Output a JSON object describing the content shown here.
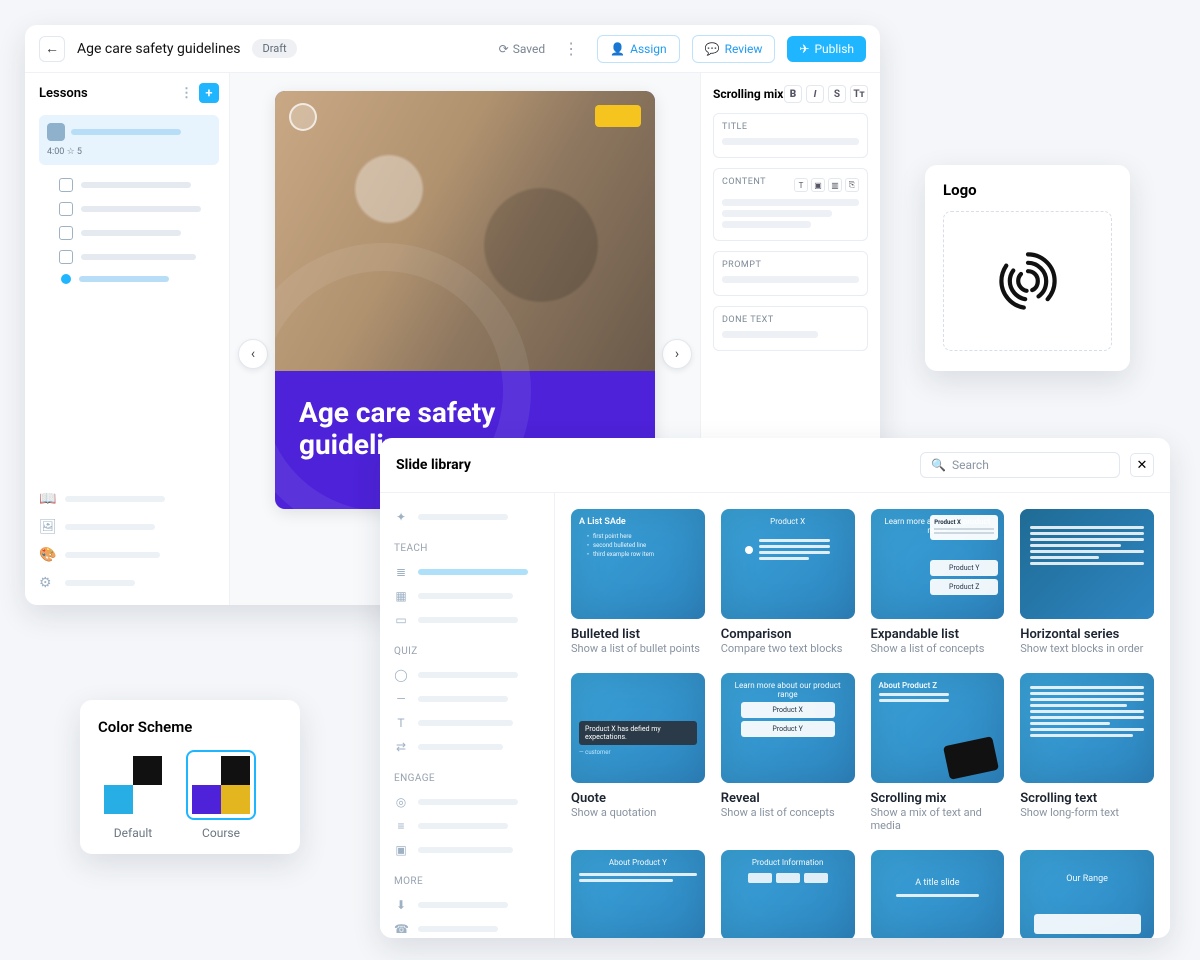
{
  "editor": {
    "title": "Age care safety guidelines",
    "status_pill": "Draft",
    "saved_label": "Saved",
    "buttons": {
      "assign": "Assign",
      "review": "Review",
      "publish": "Publish"
    },
    "lessons_label": "Lessons",
    "lesson_meta": "4:00  ☆ 5",
    "slide_title": "Age care safety guidelines",
    "props": {
      "name": "Scrolling mix",
      "groups": {
        "title": "TITLE",
        "content": "CONTENT",
        "prompt": "PROMPT",
        "done": "DONE TEXT"
      }
    }
  },
  "logo_card": {
    "heading": "Logo"
  },
  "library": {
    "heading": "Slide library",
    "search_placeholder": "Search",
    "sections": {
      "teach": "TEACH",
      "quiz": "QUIZ",
      "engage": "ENGAGE",
      "more": "MORE"
    },
    "templates": [
      {
        "name": "Bulleted list",
        "desc": "Show a list of bullet points",
        "thumb_title": "A List SAde"
      },
      {
        "name": "Comparison",
        "desc": "Compare two text blocks",
        "thumb_title": "Product X"
      },
      {
        "name": "Expandable list",
        "desc": "Show a list of concepts",
        "thumb_title": "Learn more about our product range",
        "items": [
          "Product X",
          "Product Y",
          "Product Z"
        ]
      },
      {
        "name": "Horizontal series",
        "desc": "Show text blocks in order"
      },
      {
        "name": "Quote",
        "desc": "Show a quotation",
        "thumb_quote": "Product X has defied my expectations."
      },
      {
        "name": "Reveal",
        "desc": "Show a list of concepts",
        "thumb_title": "Learn more about our product range",
        "items": [
          "Product X",
          "Product Y"
        ]
      },
      {
        "name": "Scrolling mix",
        "desc": "Show a mix of text and media",
        "thumb_title": "About Product Z"
      },
      {
        "name": "Scrolling text",
        "desc": "Show long-form text"
      },
      {
        "name": "",
        "desc": "",
        "thumb_title": "About Product Y"
      },
      {
        "name": "",
        "desc": "",
        "thumb_title": "Product Information"
      },
      {
        "name": "",
        "desc": "",
        "thumb_title": "A title slide"
      },
      {
        "name": "",
        "desc": "",
        "thumb_title": "Our Range"
      }
    ]
  },
  "scheme": {
    "heading": "Color Scheme",
    "options": [
      {
        "label": "Default",
        "colors": [
          "#ffffff",
          "#111111",
          "#27aee5",
          "#ffffff"
        ]
      },
      {
        "label": "Course",
        "colors": [
          "#ffffff",
          "#111111",
          "#4d22d8",
          "#e3b51f"
        ]
      }
    ]
  }
}
